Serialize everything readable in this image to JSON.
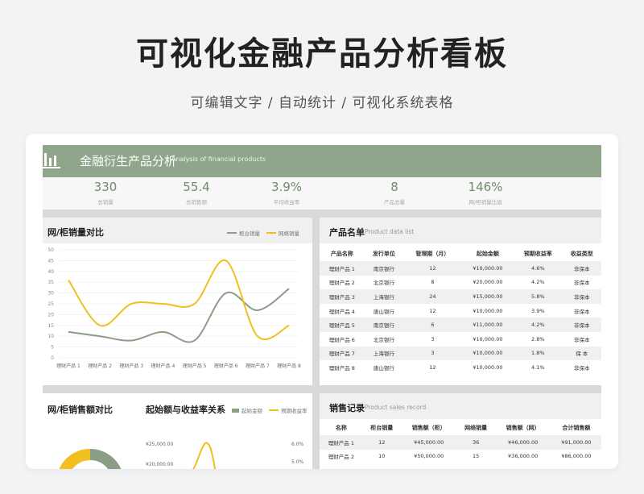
{
  "hero": {
    "title": "可视化金融产品分析看板",
    "subtitle": "可编辑文字 / 自动统计 / 可视化系统表格"
  },
  "banner": {
    "icon": "bar-chart-icon",
    "title": "金融衍生产品分析",
    "title_en": "Analysis of financial products",
    "color": "#8fa68a"
  },
  "kpis": [
    {
      "value": "330",
      "label": "总销量"
    },
    {
      "value": "55.4",
      "label": "总销售额"
    },
    {
      "value": "3.9%",
      "label": "平均收益率"
    },
    {
      "value": "8",
      "label": "产品总量"
    },
    {
      "value": "146%",
      "label": "网/柜销量比值"
    }
  ],
  "line_panel": {
    "title": "网/柜销量对比",
    "legend": [
      "柜台销量",
      "网络销量"
    ]
  },
  "chart_data": {
    "type": "line",
    "categories": [
      "理财产品 1",
      "理财产品 2",
      "理财产品 3",
      "理财产品 4",
      "理财产品 5",
      "理财产品 6",
      "理财产品 7",
      "理财产品 8"
    ],
    "series": [
      {
        "name": "柜台销量",
        "values": [
          12,
          10,
          8,
          12,
          8,
          30,
          22,
          32
        ],
        "color": "#8a9e86"
      },
      {
        "name": "网络销量",
        "values": [
          36,
          15,
          25,
          25,
          25,
          45,
          10,
          15
        ],
        "color": "#f2c01e"
      }
    ],
    "yticks": [
      "0",
      "5",
      "10",
      "15",
      "20",
      "25",
      "30",
      "35",
      "40",
      "45",
      "50"
    ],
    "ylim": [
      0,
      50
    ]
  },
  "bottom_left": {
    "title1": "网/柜销售额对比",
    "title2": "起始额与收益率关系",
    "legend": [
      "起始金额",
      "预期收益率"
    ],
    "yleft": [
      "¥25,000.00",
      "¥20,000.00"
    ],
    "yright": [
      "6.0%",
      "5.0%"
    ]
  },
  "product_panel": {
    "title": "产品名单",
    "subtitle": "Product data list",
    "headers": [
      "产品名称",
      "发行单位",
      "管理期（月）",
      "起始金额",
      "预期收益率",
      "收益类型"
    ],
    "rows": [
      [
        "理财产品 1",
        "南京银行",
        "12",
        "¥10,000.00",
        "4.6%",
        "非保本"
      ],
      [
        "理财产品 2",
        "北京银行",
        "8",
        "¥20,000.00",
        "4.2%",
        "非保本"
      ],
      [
        "理财产品 3",
        "上海银行",
        "24",
        "¥15,000.00",
        "5.8%",
        "非保本"
      ],
      [
        "理财产品 4",
        "唐山银行",
        "12",
        "¥10,000.00",
        "3.9%",
        "非保本"
      ],
      [
        "理财产品 5",
        "南京银行",
        "6",
        "¥11,000.00",
        "4.2%",
        "非保本"
      ],
      [
        "理财产品 6",
        "北京银行",
        "3",
        "¥10,000.00",
        "2.8%",
        "非保本"
      ],
      [
        "理财产品 7",
        "上海银行",
        "3",
        "¥10,000.00",
        "1.8%",
        "保 本"
      ],
      [
        "理财产品 8",
        "唐山银行",
        "12",
        "¥10,000.00",
        "4.1%",
        "非保本"
      ]
    ]
  },
  "sales_panel": {
    "title": "销售记录",
    "subtitle": "Product sales record",
    "headers": [
      "名称",
      "柜台销量",
      "销售额（柜）",
      "网络销量",
      "销售额（网）",
      "合计销售额"
    ],
    "rows": [
      [
        "理财产品 1",
        "12",
        "¥45,000.00",
        "36",
        "¥46,000.00",
        "¥91,000.00"
      ],
      [
        "理财产品 2",
        "10",
        "¥50,000.00",
        "15",
        "¥36,000.00",
        "¥86,000.00"
      ]
    ]
  }
}
